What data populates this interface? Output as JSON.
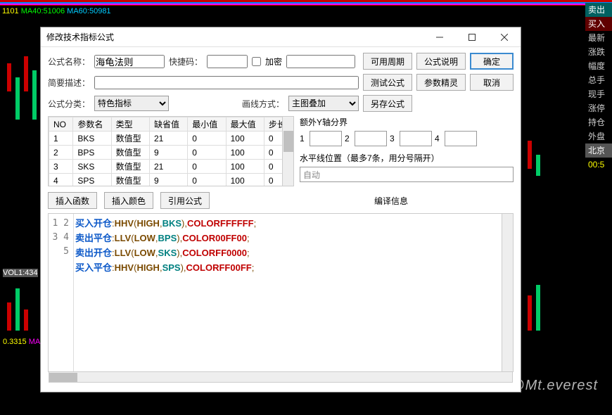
{
  "bg": {
    "ma_line": "1101",
    "ma40": "MA40:51006",
    "ma60": "MA60:50981",
    "vol": "VOL1:434",
    "ma5": "0.3315",
    "ma5b": "MA"
  },
  "side": {
    "sell": "卖出",
    "buy": "买入",
    "items": [
      "最新",
      "涨跌",
      "幅度",
      "总手",
      "现手",
      "涨停",
      "持仓",
      "外盘"
    ],
    "city": "北京",
    "time": "00:5"
  },
  "dialog": {
    "title": "修改技术指标公式",
    "labels": {
      "name": "公式名称：",
      "hotkey": "快捷码：",
      "encrypt": "加密",
      "desc": "简要描述：",
      "category": "公式分类：",
      "drawmode": "画线方式：",
      "yaxis": "额外Y轴分界",
      "hlines": "水平线位置（最多7条，用分号隔开）",
      "compile": "编译信息"
    },
    "name_value": "海龟法则",
    "category_value": "特色指标",
    "drawmode_value": "主图叠加",
    "hlines_value": "自动",
    "yaxis_nums": [
      "1",
      "2",
      "3",
      "4"
    ],
    "buttons": {
      "period": "可用周期",
      "explain": "公式说明",
      "ok": "确定",
      "test": "测试公式",
      "wizard": "参数精灵",
      "cancel": "取消",
      "saveas": "另存公式",
      "insert_fn": "插入函数",
      "insert_color": "插入颜色",
      "ref_formula": "引用公式"
    },
    "param_headers": [
      "NO",
      "参数名",
      "类型",
      "缺省值",
      "最小值",
      "最大值",
      "步长"
    ],
    "params": [
      {
        "no": "1",
        "name": "BKS",
        "type": "数值型",
        "def": "21",
        "min": "0",
        "max": "100",
        "step": "0"
      },
      {
        "no": "2",
        "name": "BPS",
        "type": "数值型",
        "def": "9",
        "min": "0",
        "max": "100",
        "step": "0"
      },
      {
        "no": "3",
        "name": "SKS",
        "type": "数值型",
        "def": "21",
        "min": "0",
        "max": "100",
        "step": "0"
      },
      {
        "no": "4",
        "name": "SPS",
        "type": "数值型",
        "def": "9",
        "min": "0",
        "max": "100",
        "step": "0"
      }
    ],
    "code_lines": [
      {
        "n": "1",
        "cn": "买入开仓",
        "fn": "HHV",
        "arg1": "HIGH",
        "param": "BKS",
        "color": "COLORFFFFFF"
      },
      {
        "n": "2",
        "cn": "卖出平仓",
        "fn": "LLV",
        "arg1": "LOW",
        "param": "BPS",
        "color": "COLOR00FF00"
      },
      {
        "n": "3",
        "cn": "卖出开仓",
        "fn": "LLV",
        "arg1": "LOW",
        "param": "SKS",
        "color": "COLORFF0000"
      },
      {
        "n": "4",
        "cn": "买入平仓",
        "fn": "HHV",
        "arg1": "HIGH",
        "param": "SPS",
        "color": "COLORFF00FF"
      }
    ],
    "gutter_extra": "5"
  },
  "watermark": "知乎 @Mt.everest"
}
